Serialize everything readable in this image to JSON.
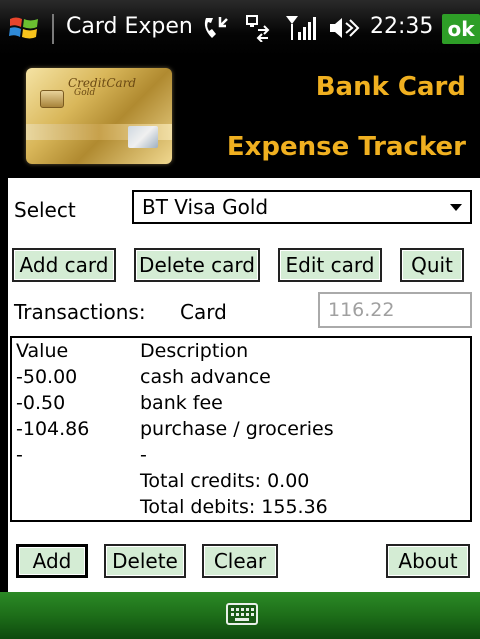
{
  "statusbar": {
    "title": "Card Expen",
    "time": "22:35",
    "ok_label": "ok",
    "icons": [
      "windows-logo-icon",
      "missed-call-icon",
      "sync-icon",
      "signal-icon",
      "speaker-icon"
    ]
  },
  "banner": {
    "line1": "Bank Card",
    "line2": "Expense Tracker",
    "card_brand": "CreditCard",
    "card_sub": "Gold"
  },
  "form": {
    "select_label": "Select",
    "selected_card": "BT Visa Gold",
    "buttons": {
      "add_card": "Add card",
      "delete_card": "Delete card",
      "edit_card": "Edit card",
      "quit": "Quit"
    },
    "transactions_label": "Transactions:",
    "card_label": "Card",
    "amount_placeholder": "116.22"
  },
  "transactions": {
    "headers": [
      "Value",
      "Description"
    ],
    "rows": [
      {
        "value": "-50.00",
        "description": "cash advance"
      },
      {
        "value": "-0.50",
        "description": "bank fee"
      },
      {
        "value": "-104.86",
        "description": "purchase / groceries"
      },
      {
        "value": "-",
        "description": "-"
      }
    ],
    "total_credits": "Total credits: 0.00",
    "total_debits": "Total debits: 155.36"
  },
  "actions": {
    "add": "Add",
    "delete": "Delete",
    "clear": "Clear",
    "about": "About"
  },
  "colors": {
    "banner_text": "#f0b020",
    "button_bg": "#d4ecd4",
    "ok_green": "#2e9e27",
    "softbar_green": "#1d6e19"
  }
}
